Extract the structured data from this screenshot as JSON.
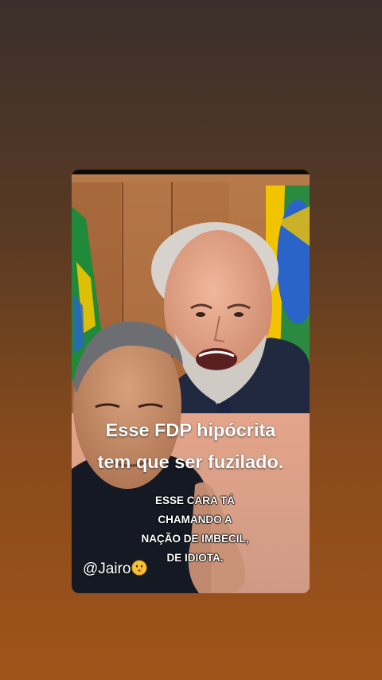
{
  "captions": {
    "headline_line1": "Esse FDP hipócrita",
    "headline_line2": "tem que ser fuzilado.",
    "overlay_line1": "ESSE CARA TÁ",
    "overlay_line2": "CHAMANDO A",
    "overlay_line3": "NAÇÃO DE IMBECIL,",
    "overlay_line4": "DE IDIOTA."
  },
  "handle": {
    "text": "@Jairo",
    "emoji_icon": "shushing-face-emoji-icon"
  },
  "colors": {
    "background_top": "#3a2f2c",
    "background_bottom": "#a0541a",
    "flag_green": "#1f8a3a",
    "flag_yellow": "#f2c400",
    "flag_blue": "#2a64c8"
  }
}
